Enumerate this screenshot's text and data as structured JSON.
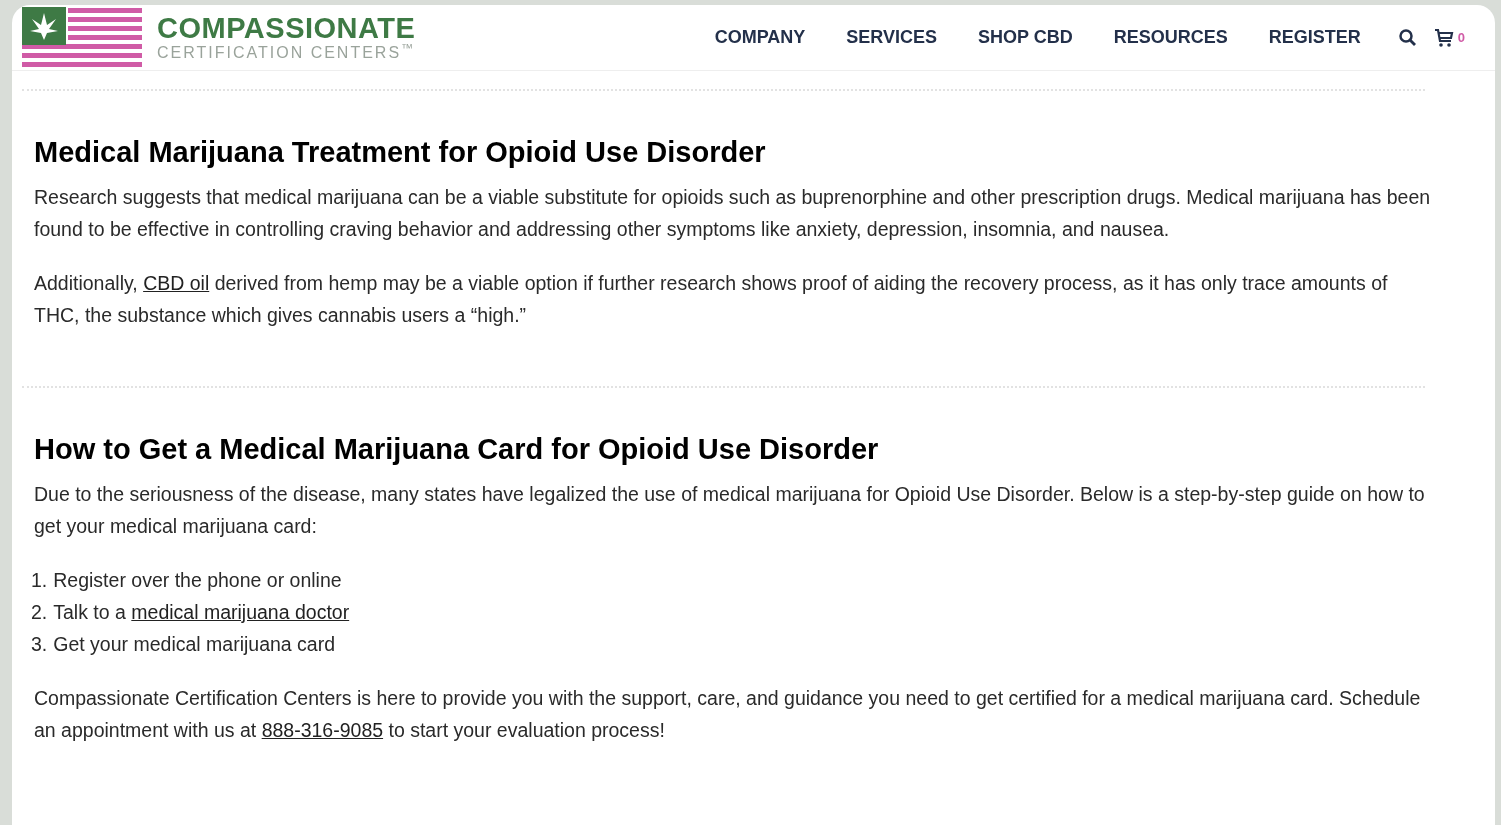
{
  "header": {
    "logo": {
      "title": "COMPASSIONATE",
      "subtitle": "CERTIFICATION CENTERS$^{™}$"
    },
    "nav": [
      "COMPANY",
      "SERVICES",
      "SHOP CBD",
      "RESOURCES",
      "REGISTER"
    ],
    "cart_count": "0"
  },
  "sections": [
    {
      "heading": "Medical Marijuana Treatment for Opioid Use Disorder",
      "blocks": [
        {
          "kind": "paragraph",
          "parts": [
            {
              "text": "Research suggests that medical marijuana can be a viable substitute for opioids such as buprenorphine and other prescription drugs. Medical marijuana has been found to be effective in controlling craving behavior and addressing other symptoms like anxiety, depression, insomnia, and nausea."
            }
          ]
        },
        {
          "kind": "paragraph",
          "parts": [
            {
              "text": "Additionally, "
            },
            {
              "text": "CBD oil",
              "link": true
            },
            {
              "text": " derived from hemp may be a viable option if further research shows proof of aiding the recovery process, as it has only trace amounts of THC, the substance which gives cannabis users a “high.”"
            }
          ]
        }
      ]
    },
    {
      "heading": "How to Get a Medical Marijuana Card for Opioid Use Disorder",
      "blocks": [
        {
          "kind": "paragraph",
          "parts": [
            {
              "text": "Due to the seriousness of the disease, many states have legalized the use of medical marijuana for Opioid Use Disorder. Below is a step-by-step guide on how to get your medical marijuana card:"
            }
          ]
        },
        {
          "kind": "list",
          "items": [
            {
              "number": "1.",
              "parts": [
                {
                  "text": "Register over the phone or online"
                }
              ]
            },
            {
              "number": "2.",
              "parts": [
                {
                  "text": "Talk to a "
                },
                {
                  "text": "medical marijuana doctor",
                  "link": true
                }
              ]
            },
            {
              "number": "3.",
              "parts": [
                {
                  "text": "Get your medical marijuana card"
                }
              ]
            }
          ]
        },
        {
          "kind": "paragraph",
          "parts": [
            {
              "text": "Compassionate Certification Centers is here to provide you with the support, care, and guidance you need to get certified for a medical marijuana card. Schedule an appointment with us at "
            },
            {
              "text": "888-316-9085",
              "link": true
            },
            {
              "text": " to start your evaluation process!"
            }
          ]
        }
      ]
    }
  ]
}
